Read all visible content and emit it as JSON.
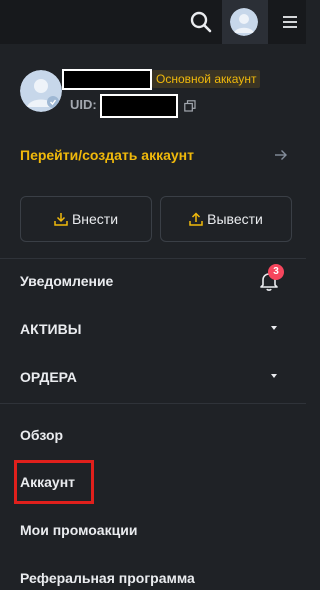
{
  "header": {
    "icons": [
      "search-icon",
      "avatar",
      "menu-icon"
    ]
  },
  "profile": {
    "account_badge": "Основной аккаунт",
    "uid_label": "UID:"
  },
  "goto_account": {
    "label": "Перейти/создать аккаунт",
    "icon": "arrow-right-icon"
  },
  "actions": {
    "deposit_label": "Внести",
    "withdraw_label": "Вывести"
  },
  "menu": {
    "notifications_label": "Уведомление",
    "notifications_count": "3",
    "assets_label": "АКТИВЫ",
    "orders_label": "ОРДЕРА",
    "overview_label": "Обзор",
    "account_label": "Аккаунт",
    "promos_label": "Мои промоакции",
    "referral_label": "Реферальная программа"
  },
  "colors": {
    "accent": "#f0b90b",
    "background": "#1f2226",
    "topbar": "#17191c",
    "badge_red": "#f6465d",
    "highlight_red": "#e0201c"
  }
}
